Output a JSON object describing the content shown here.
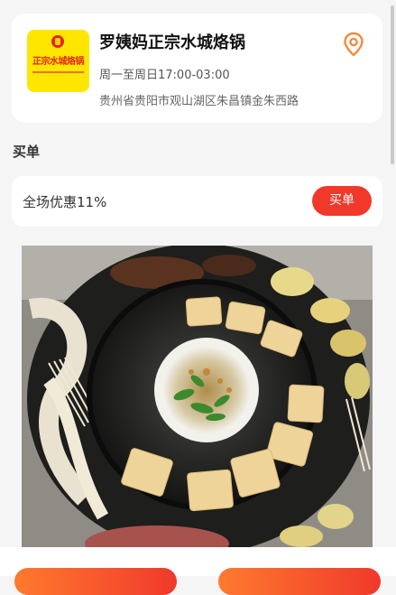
{
  "store": {
    "logo_text": "正宗水城烙锅",
    "name": "罗姨妈正宗水城烙锅",
    "hours": "周一至周日17:00-03:00",
    "address": "贵州省贵阳市观山湖区朱昌镇金朱西路"
  },
  "section": {
    "title": "买单"
  },
  "discount": {
    "text": "全场优惠11%",
    "button_label": "买单"
  },
  "colors": {
    "accent": "#f0392b",
    "location_icon": "#f28a3b",
    "logo_bg": "#ffe600"
  },
  "icons": {
    "location": "location-pin-icon"
  }
}
